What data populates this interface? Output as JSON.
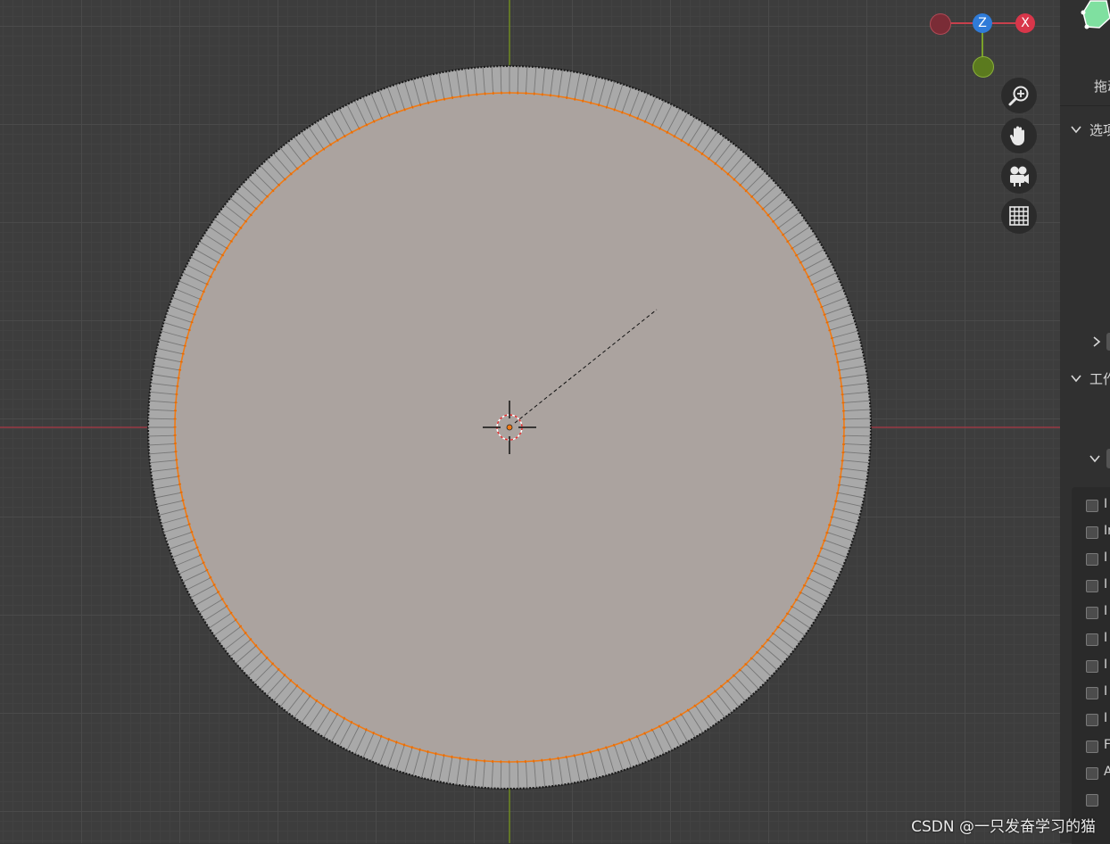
{
  "viewport": {
    "gizmo": {
      "z_label": "Z",
      "x_label": "X"
    },
    "nav_buttons": [
      "zoom",
      "pan",
      "camera",
      "ortho-grid"
    ],
    "mesh_face_color": "#aba39f",
    "mesh_rim_color": "#a9a9a9",
    "selected_edge_color": "#f07a14",
    "x_axis_color": "#9a3a45",
    "y_axis_color": "#6e8a22"
  },
  "sidebar": {
    "hint_text": "拖动",
    "section_options": "选项",
    "section_workspace": "工作",
    "checkbox_labels": [
      "I",
      "Ir",
      "I",
      "I",
      "I",
      "I",
      "I",
      "I",
      "I",
      "F",
      "A",
      ""
    ]
  },
  "watermark": "CSDN @一只发奋学习的猫"
}
